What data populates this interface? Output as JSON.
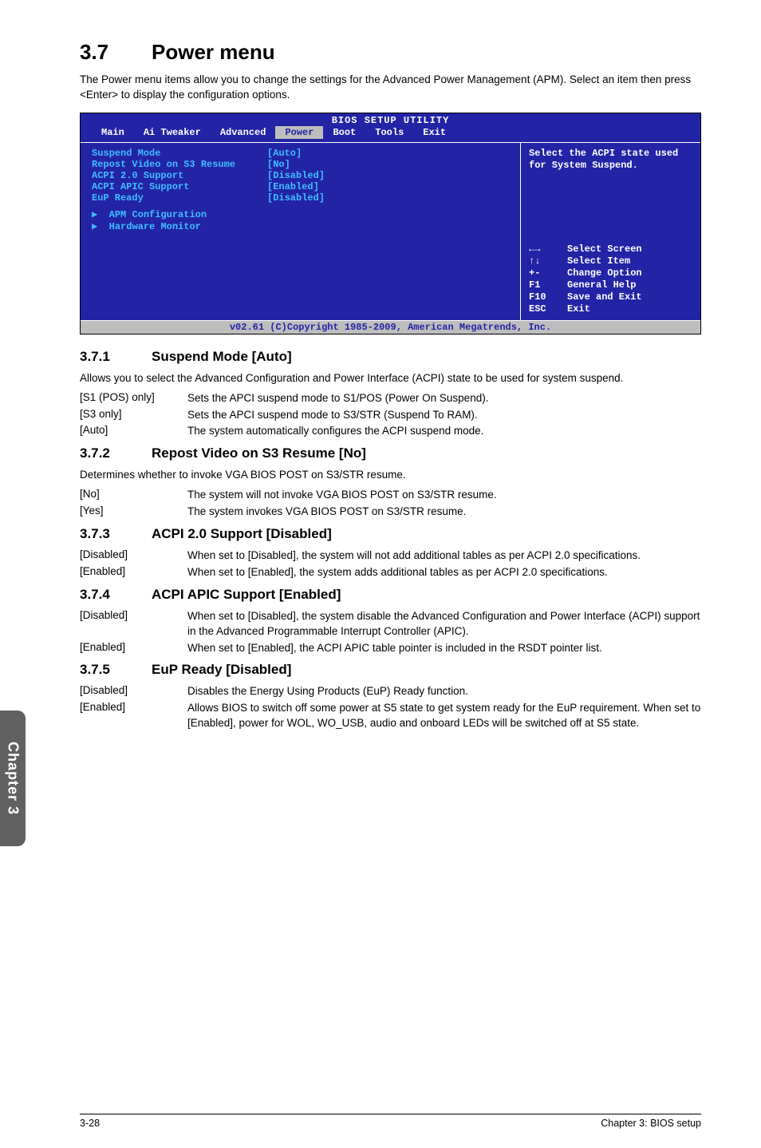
{
  "section": {
    "number": "3.7",
    "title": "Power menu"
  },
  "intro": "The Power menu items allow you to change the settings for the Advanced Power Management (APM). Select an item then press <Enter> to display the configuration options.",
  "bios": {
    "headerTitle": "BIOS SETUP UTILITY",
    "tabs": [
      "Main",
      "Ai Tweaker",
      "Advanced",
      "Power",
      "Boot",
      "Tools",
      "Exit"
    ],
    "activeTab": "Power",
    "settings": [
      {
        "label": "Suspend Mode",
        "value": "[Auto]"
      },
      {
        "label": "Repost Video on S3 Resume",
        "value": "[No]"
      },
      {
        "label": "ACPI 2.0 Support",
        "value": "[Disabled]"
      },
      {
        "label": "ACPI APIC Support",
        "value": "[Enabled]"
      },
      {
        "label": "EuP Ready",
        "value": "[Disabled]"
      }
    ],
    "submenus": [
      "APM Configuration",
      "Hardware Monitor"
    ],
    "helpText": "Select the ACPI state used for System Suspend.",
    "keys": [
      {
        "k": "←→",
        "a": "Select Screen"
      },
      {
        "k": "↑↓",
        "a": "Select Item"
      },
      {
        "k": "+-",
        "a": "Change Option"
      },
      {
        "k": "F1",
        "a": "General Help"
      },
      {
        "k": "F10",
        "a": "Save and Exit"
      },
      {
        "k": "ESC",
        "a": "Exit"
      }
    ],
    "copyright": "v02.61 (C)Copyright 1985-2009, American Megatrends, Inc."
  },
  "subs": {
    "s371": {
      "num": "3.7.1",
      "title": "Suspend Mode [Auto]",
      "desc": "Allows you to select the Advanced Configuration and Power Interface (ACPI) state to be used for system suspend.",
      "defs": [
        {
          "k": "[S1 (POS) only]",
          "v": "Sets the APCI suspend mode to S1/POS (Power On Suspend)."
        },
        {
          "k": "[S3 only]",
          "v": "Sets the APCI suspend mode to S3/STR (Suspend To RAM)."
        },
        {
          "k": "[Auto]",
          "v": "The system automatically configures the ACPI suspend mode."
        }
      ]
    },
    "s372": {
      "num": "3.7.2",
      "title": "Repost Video on S3 Resume [No]",
      "desc": "Determines whether to invoke VGA BIOS POST on S3/STR resume.",
      "defs": [
        {
          "k": "[No]",
          "v": "The system will not invoke VGA BIOS POST on S3/STR resume."
        },
        {
          "k": "[Yes]",
          "v": "The system invokes VGA BIOS POST on S3/STR resume."
        }
      ]
    },
    "s373": {
      "num": "3.7.3",
      "title": "ACPI 2.0 Support [Disabled]",
      "defs": [
        {
          "k": "[Disabled]",
          "v": "When set to [Disabled], the system will not add additional tables as per ACPI 2.0 specifications."
        },
        {
          "k": "[Enabled]",
          "v": "When set to [Enabled], the system adds additional tables as per ACPI 2.0 specifications."
        }
      ]
    },
    "s374": {
      "num": "3.7.4",
      "title": "ACPI APIC Support [Enabled]",
      "defs": [
        {
          "k": "[Disabled]",
          "v": "When set to [Disabled], the system disable the Advanced Configuration and Power Interface (ACPI) support in the Advanced Programmable Interrupt Controller (APIC)."
        },
        {
          "k": "[Enabled]",
          "v": "When set to [Enabled], the ACPI APIC table pointer is included in the RSDT pointer list."
        }
      ]
    },
    "s375": {
      "num": "3.7.5",
      "title": "EuP Ready [Disabled]",
      "defs": [
        {
          "k": "[Disabled]",
          "v": "Disables the Energy Using Products (EuP) Ready function."
        },
        {
          "k": "[Enabled]",
          "v": "Allows BIOS to switch off some power at S5 state to get system ready for the EuP requirement. When set to [Enabled], power for WOL, WO_USB, audio and onboard LEDs will be switched off at S5 state."
        }
      ]
    }
  },
  "sideTab": "Chapter 3",
  "footer": {
    "left": "3-28",
    "right": "Chapter 3: BIOS setup"
  }
}
